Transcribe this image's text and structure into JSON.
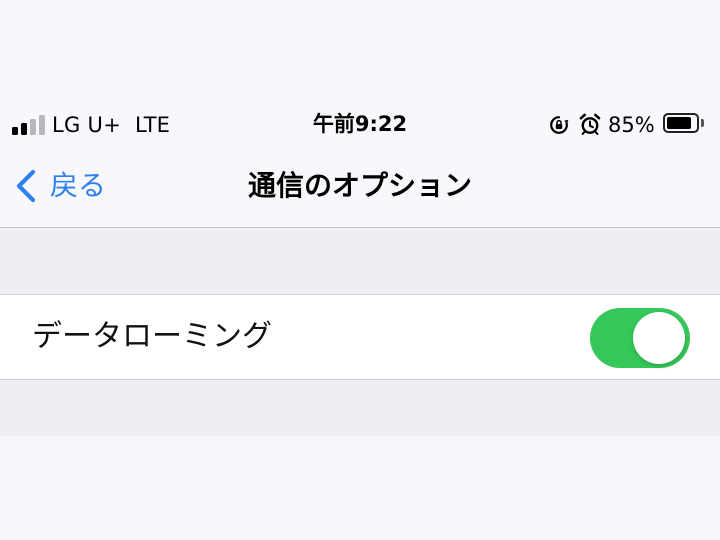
{
  "status_bar": {
    "carrier": "LG U+",
    "network": "LTE",
    "time": "午前9:22",
    "battery_percent": "85%",
    "battery_level": 0.85,
    "signal_bars_filled": 2,
    "signal_bars_total": 4,
    "icons": [
      "orientation-lock-icon",
      "alarm-clock-icon"
    ]
  },
  "nav": {
    "back_label": "戻る",
    "title": "通信のオプション",
    "accent_color": "#2f80ed"
  },
  "settings": {
    "items": [
      {
        "label": "データローミング",
        "toggle_on": true,
        "toggle_color": "#35c759"
      }
    ]
  }
}
